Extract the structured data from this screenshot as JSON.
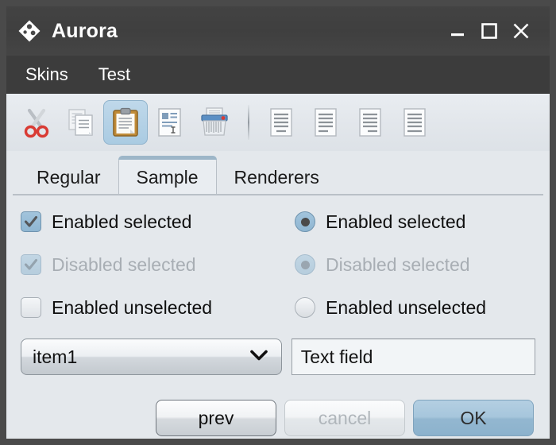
{
  "window": {
    "title": "Aurora",
    "logo_icon": "diamond-logo-icon",
    "controls": {
      "minimize": "minimize-icon",
      "maximize": "maximize-icon",
      "close": "close-icon"
    }
  },
  "menubar": {
    "items": [
      {
        "label": "Skins"
      },
      {
        "label": "Test"
      }
    ]
  },
  "toolbar": {
    "buttons": [
      {
        "name": "cut-icon",
        "selected": false
      },
      {
        "name": "copy-icon",
        "selected": false
      },
      {
        "name": "paste-icon",
        "selected": true
      },
      {
        "name": "paste-special-icon",
        "selected": false
      },
      {
        "name": "shredder-icon",
        "selected": false
      }
    ],
    "align_buttons": [
      {
        "name": "align-center-icon"
      },
      {
        "name": "align-left-icon"
      },
      {
        "name": "align-right-icon"
      },
      {
        "name": "align-justify-icon"
      }
    ]
  },
  "tabs": [
    {
      "label": "Regular",
      "active": false
    },
    {
      "label": "Sample",
      "active": true
    },
    {
      "label": "Renderers",
      "active": false
    }
  ],
  "options": {
    "checkboxes": [
      {
        "label": "Enabled selected",
        "checked": true,
        "enabled": true
      },
      {
        "label": "Disabled selected",
        "checked": true,
        "enabled": false
      },
      {
        "label": "Enabled unselected",
        "checked": false,
        "enabled": true
      }
    ],
    "radios": [
      {
        "label": "Enabled selected",
        "checked": true,
        "enabled": true
      },
      {
        "label": "Disabled selected",
        "checked": true,
        "enabled": false
      },
      {
        "label": "Enabled unselected",
        "checked": false,
        "enabled": true
      }
    ]
  },
  "combobox": {
    "value": "item1",
    "arrow_icon": "chevron-down-icon"
  },
  "textfield": {
    "value": "Text field"
  },
  "buttons": {
    "prev": "prev",
    "cancel": "cancel",
    "ok": "OK"
  },
  "colors": {
    "frame": "#4a4a4a",
    "titlebar": "#434343",
    "menubar": "#3c3c3c",
    "content": "#e4e8ec",
    "accent": "#8fb6d2",
    "tab_active_bar": "#9db6c8",
    "primary_button": "#a6c6dc"
  }
}
